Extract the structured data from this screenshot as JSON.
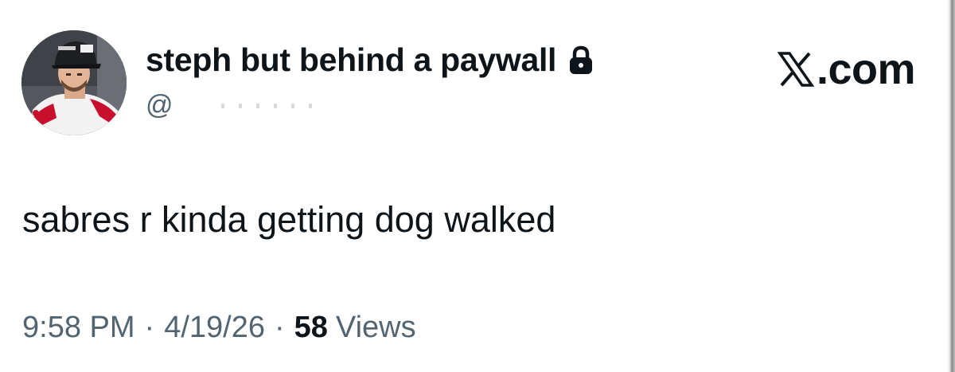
{
  "tweet": {
    "display_name": "steph but behind a paywall",
    "protected_icon": "lock-icon",
    "handle": "@",
    "brand": {
      "icon": "x-logo-icon",
      "text": ".com"
    },
    "text": "sabres r kinda getting dog walked",
    "time": "9:58 PM",
    "separator": "·",
    "date": "4/19/26",
    "views_count": "58",
    "views_label": "Views"
  },
  "colors": {
    "text_primary": "#0f1419",
    "text_secondary": "#536471",
    "background": "#ffffff"
  }
}
